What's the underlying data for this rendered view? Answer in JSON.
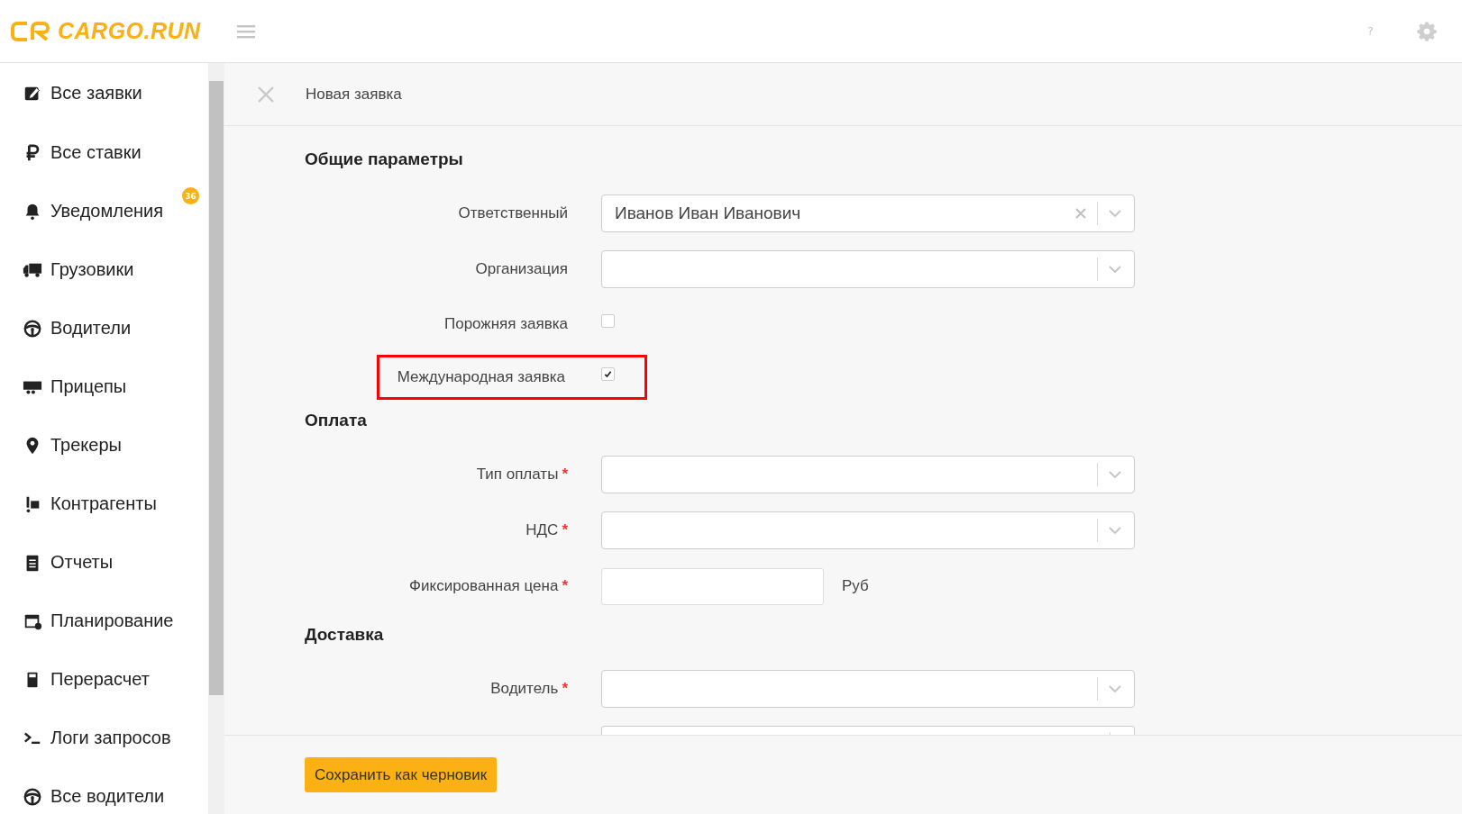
{
  "logo": {
    "text": "CARGO.RUN"
  },
  "sidebar": {
    "items": [
      {
        "label": "Все заявки",
        "selected": false
      },
      {
        "label": "Все ставки",
        "selected": false
      },
      {
        "label": "Уведомления",
        "selected": false,
        "badge": "36"
      },
      {
        "label": "Грузовики",
        "selected": false
      },
      {
        "label": "Водители",
        "selected": false
      },
      {
        "label": "Прицепы",
        "selected": false
      },
      {
        "label": "Трекеры",
        "selected": false
      },
      {
        "label": "Контрагенты",
        "selected": false
      },
      {
        "label": "Отчеты",
        "selected": false
      },
      {
        "label": "Планирование",
        "selected": false
      },
      {
        "label": "Перерасчет",
        "selected": false
      },
      {
        "label": "Логи запросов",
        "selected": false
      },
      {
        "label": "Все водители",
        "selected": false
      }
    ]
  },
  "header_help": "?",
  "page": {
    "title": "Новая заявка"
  },
  "sections": [
    {
      "title": "Общие параметры",
      "fields": [
        {
          "kind": "select",
          "label": "Ответственный",
          "value": "Иванов Иван Иванович",
          "clearable": true
        },
        {
          "kind": "select",
          "label": "Организация",
          "clearable": false
        },
        {
          "kind": "checkbox",
          "label": "Порожняя заявка",
          "checked": false,
          "highlighted": false
        },
        {
          "kind": "checkbox",
          "label": "Международная заявка",
          "checked": true,
          "highlighted": true
        }
      ]
    },
    {
      "title": "Оплата",
      "fields": [
        {
          "kind": "select",
          "label": "Тип оплаты",
          "required_mark": "*",
          "clearable": false
        },
        {
          "kind": "select",
          "label": "НДС",
          "required_mark": "*",
          "clearable": false
        },
        {
          "kind": "text",
          "label": "Фиксированная цена",
          "required_mark": "*",
          "unit": "Руб"
        }
      ]
    },
    {
      "title": "Доставка",
      "fields": [
        {
          "kind": "select",
          "label": "Водитель",
          "required_mark": "*",
          "clearable": false
        },
        {
          "kind": "select",
          "clearable": false
        }
      ]
    }
  ],
  "footer": {
    "button": "Сохранить как черновик"
  }
}
